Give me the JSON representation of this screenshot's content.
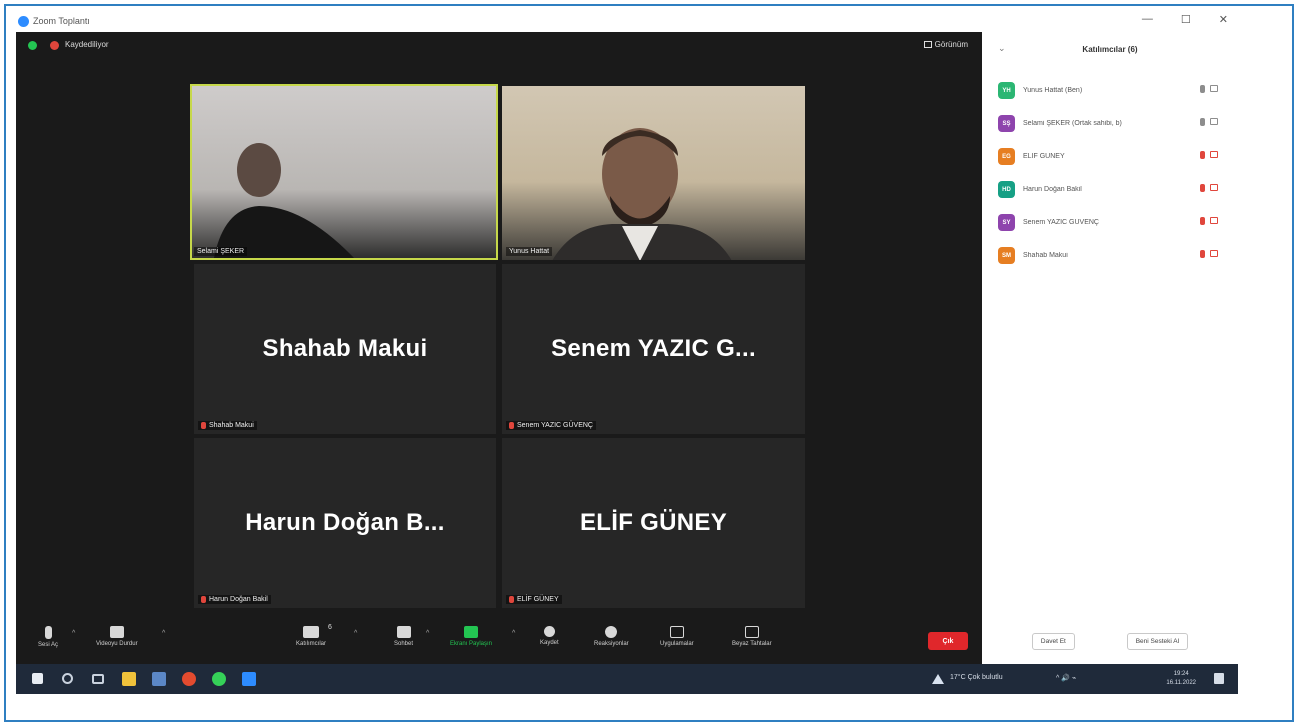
{
  "window": {
    "title": "Zoom Toplantı",
    "controls": [
      "—",
      "☐",
      "✕"
    ]
  },
  "meeting": {
    "recording_label": "Kaydediliyor",
    "view_label": "Görünüm",
    "tiles": [
      {
        "type": "video",
        "name": "Selami ŞEKER"
      },
      {
        "type": "video",
        "name": "Yunus Hattat"
      },
      {
        "type": "avatar",
        "display": "Shahab Makui",
        "name": "Shahab Makui"
      },
      {
        "type": "avatar",
        "display": "Senem YAZIC G...",
        "name": "Senem YAZIC GÜVENÇ"
      },
      {
        "type": "avatar",
        "display": "Harun Doğan B...",
        "name": "Harun Doğan Bakil"
      },
      {
        "type": "avatar",
        "display": "ELİF GÜNEY",
        "name": "ELİF GÜNEY"
      }
    ]
  },
  "toolbar": {
    "mute": "Sesi Aç",
    "video": "Videoyu Durdur",
    "participants": "Katılımcılar",
    "participants_count": "6",
    "chat": "Sohbet",
    "share": "Ekranı Paylaşın",
    "record": "Kaydet",
    "reactions": "Reaksiyonlar",
    "apps": "Uygulamalar",
    "whiteboards": "Beyaz Tahtalar",
    "leave": "Çık",
    "colors": {
      "share": "#23c552",
      "leave": "#e0272b"
    }
  },
  "panel": {
    "title": "Katılımcılar (6)",
    "participants": [
      {
        "initials": "YH",
        "name": "Yunus Hattat (Ben)",
        "color": "#2bb673",
        "mic_muted": false,
        "cam_off": false
      },
      {
        "initials": "SŞ",
        "name": "Selami ŞEKER (Ortak sahibi, b)",
        "color": "#8e44ad",
        "mic_muted": false,
        "cam_off": false
      },
      {
        "initials": "EG",
        "name": "ELİF GÜNEY",
        "color": "#e67e22",
        "mic_muted": true,
        "cam_off": true
      },
      {
        "initials": "HD",
        "name": "Harun Doğan Bakil",
        "color": "#16a085",
        "mic_muted": true,
        "cam_off": true
      },
      {
        "initials": "SY",
        "name": "Senem YAZIC GÜVENÇ",
        "color": "#8e44ad",
        "mic_muted": true,
        "cam_off": true
      },
      {
        "initials": "SM",
        "name": "Shahab Makui",
        "color": "#e67e22",
        "mic_muted": true,
        "cam_off": true
      }
    ],
    "invite": "Davet Et",
    "unmute_me": "Beni Sesteki Al"
  },
  "taskbar": {
    "weather": "17°C Çok bulutlu",
    "tray": "^ 🔊 ⌁",
    "time": "19:24",
    "date": "16.11.2022"
  }
}
